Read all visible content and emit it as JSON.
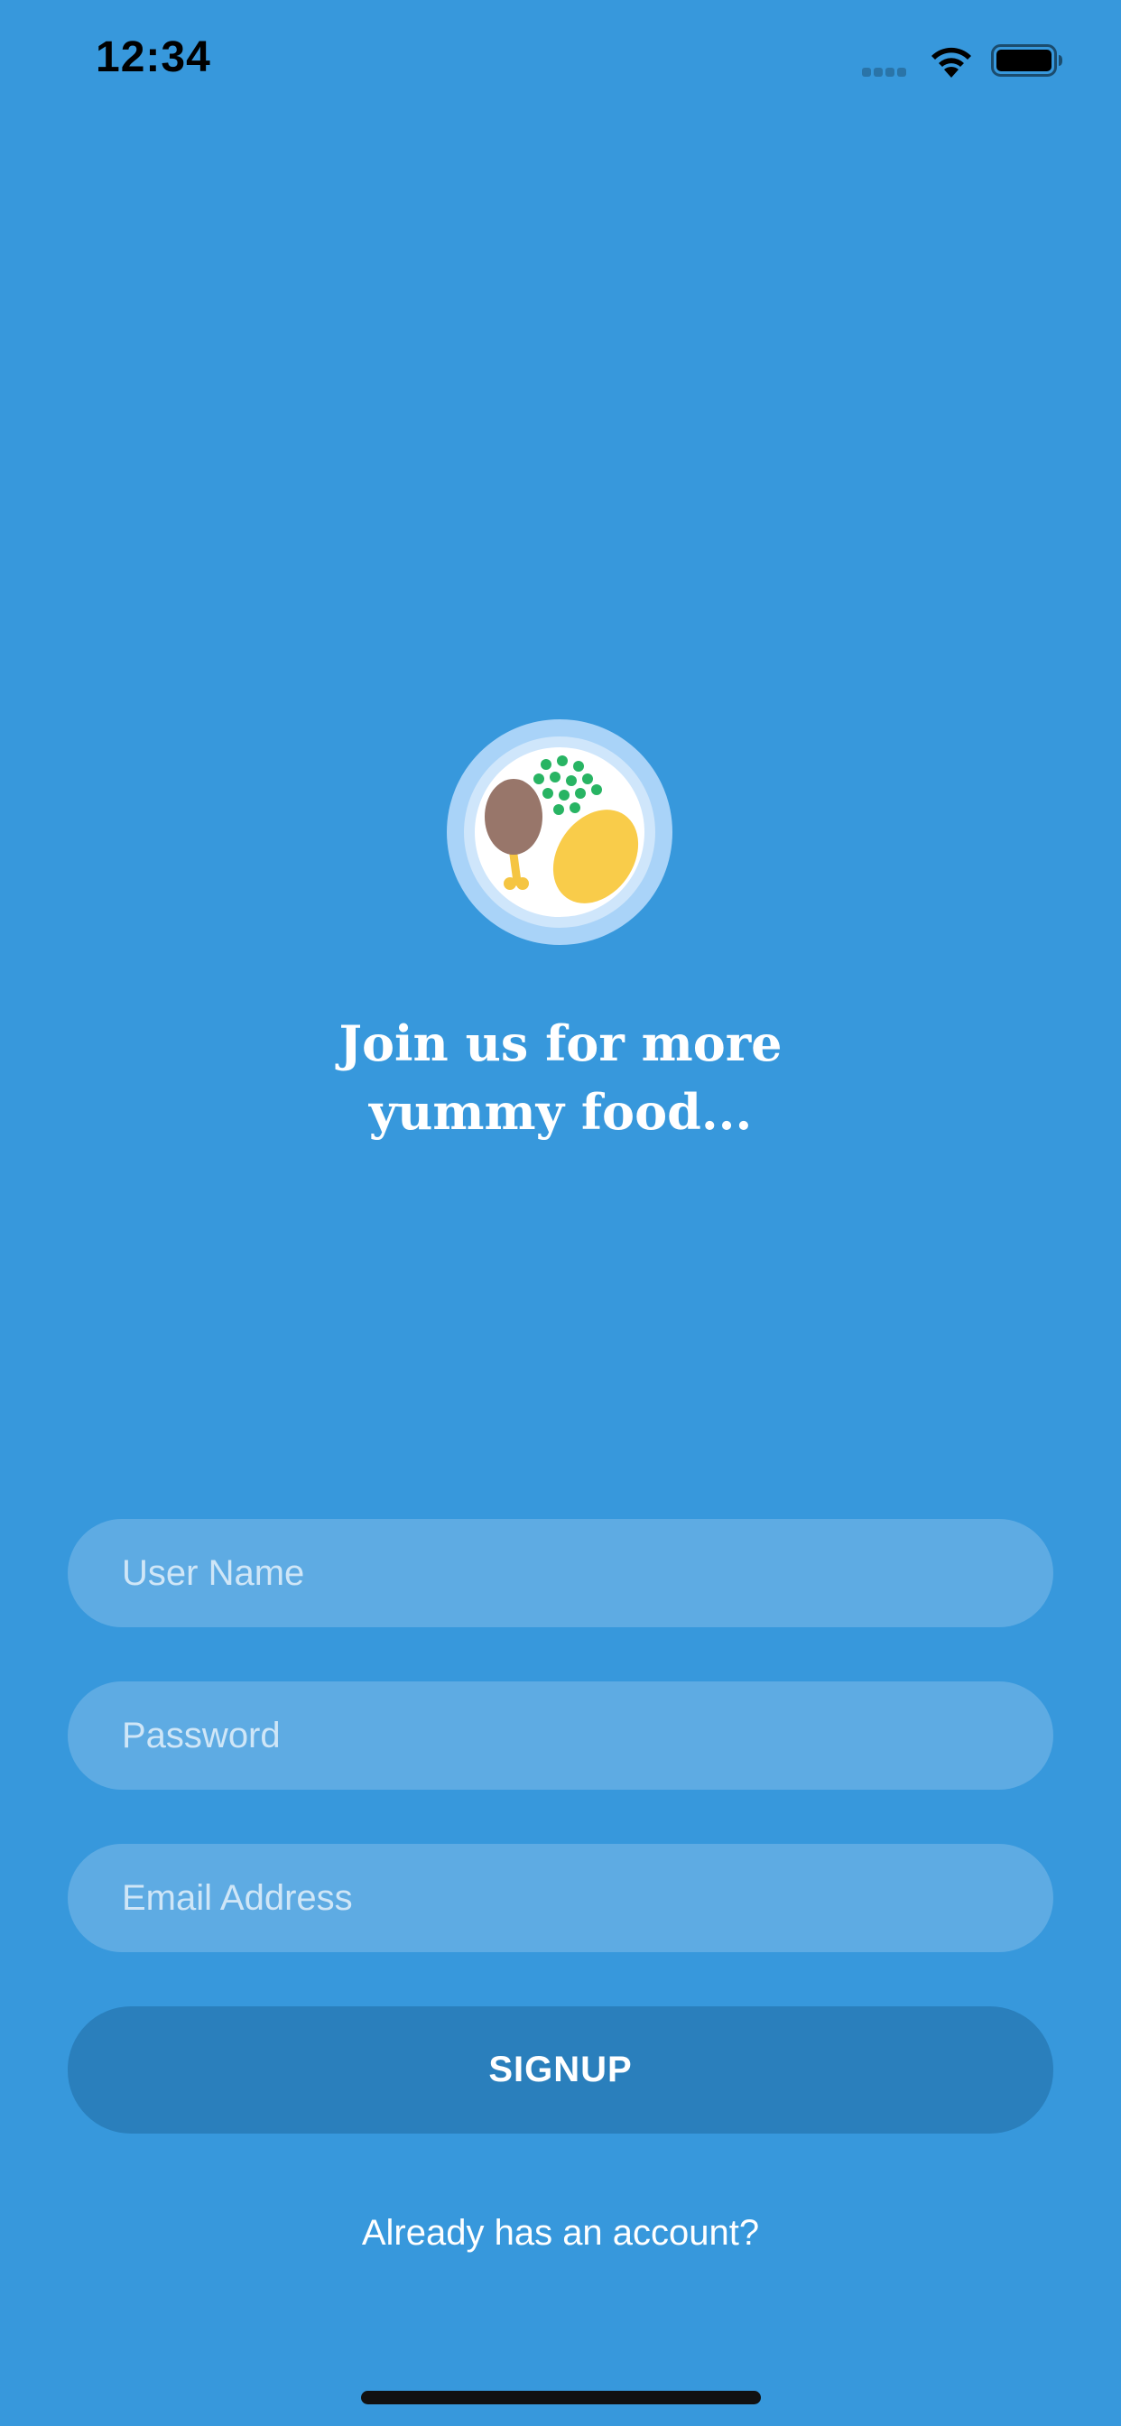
{
  "status_bar": {
    "time": "12:34",
    "signal_icon": "cellular-signal-icon",
    "wifi_icon": "wifi-icon",
    "battery_icon": "battery-icon"
  },
  "logo": {
    "icon": "food-plate-icon"
  },
  "tagline": {
    "line1": "Join us for more",
    "line2": "yummy food..."
  },
  "form": {
    "username_placeholder": "User Name",
    "username_value": "",
    "password_placeholder": "Password",
    "password_value": "",
    "email_placeholder": "Email Address",
    "email_value": "",
    "signup_label": "SIGNUP",
    "login_link": "Already has an account?"
  },
  "colors": {
    "background": "#3798dc",
    "field_fill": "#5eabe3",
    "button_fill": "#2a7fbc",
    "text": "#ffffff"
  }
}
